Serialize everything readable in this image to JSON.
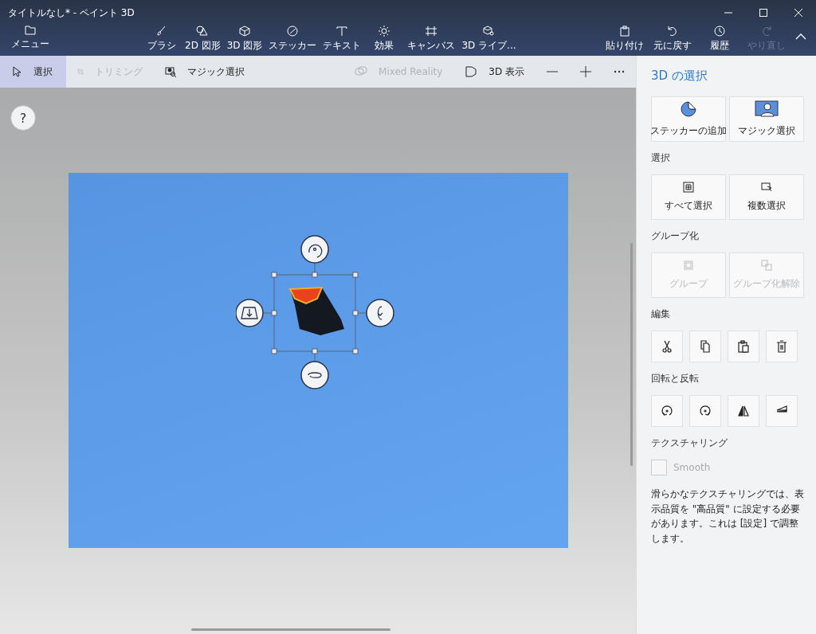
{
  "window": {
    "title": "タイトルなし* - ペイント 3D"
  },
  "toolbar": {
    "menu": {
      "label": "メニュー"
    },
    "tools": [
      {
        "label": "ブラシ"
      },
      {
        "label": "2D 図形"
      },
      {
        "label": "3D 図形"
      },
      {
        "label": "ステッカー"
      },
      {
        "label": "テキスト"
      },
      {
        "label": "効果"
      },
      {
        "label": "キャンバス"
      },
      {
        "label": "3D ライブ..."
      }
    ],
    "actions": [
      {
        "label": "貼り付け",
        "disabled": false
      },
      {
        "label": "元に戻す",
        "disabled": false
      },
      {
        "label": "履歴",
        "disabled": false
      },
      {
        "label": "やり直し",
        "disabled": true
      }
    ]
  },
  "subtoolbar": {
    "items": [
      {
        "label": "選択",
        "selected": true,
        "disabled": false
      },
      {
        "label": "トリミング",
        "selected": false,
        "disabled": true
      },
      {
        "label": "マジック選択",
        "selected": false,
        "disabled": false
      }
    ],
    "right_items": [
      {
        "label": "Mixed Reality",
        "disabled": true
      },
      {
        "label": "3D 表示",
        "disabled": false
      }
    ]
  },
  "help": {
    "label": "?"
  },
  "panel": {
    "title": "3D の選択",
    "top_buttons": [
      {
        "label": "ステッカーの追加"
      },
      {
        "label": "マジック選択"
      }
    ],
    "sections": [
      {
        "heading": "選択",
        "kind": "text",
        "buttons": [
          {
            "label": "すべて選択",
            "disabled": false
          },
          {
            "label": "複数選択",
            "disabled": false
          }
        ]
      },
      {
        "heading": "グループ化",
        "kind": "text",
        "buttons": [
          {
            "label": "グループ",
            "disabled": true
          },
          {
            "label": "グループ化解除",
            "disabled": true
          }
        ]
      },
      {
        "heading": "編集",
        "kind": "icons",
        "buttons": [
          {
            "kind": "cut"
          },
          {
            "kind": "copy"
          },
          {
            "kind": "paste"
          },
          {
            "kind": "delete"
          }
        ]
      },
      {
        "heading": "回転と反転",
        "kind": "icons",
        "buttons": [
          {
            "kind": "rotate-left"
          },
          {
            "kind": "rotate-right"
          },
          {
            "kind": "flip-h"
          },
          {
            "kind": "flip-v"
          }
        ]
      }
    ],
    "texturing": {
      "heading": "テクスチャリング",
      "checkbox": {
        "label": "Smooth",
        "checked": false,
        "disabled": true
      },
      "note": "滑らかなテクスチャリングでは、表示品質を \"高品質\" に設定する必要があります。これは [設定] で調整します。"
    }
  }
}
